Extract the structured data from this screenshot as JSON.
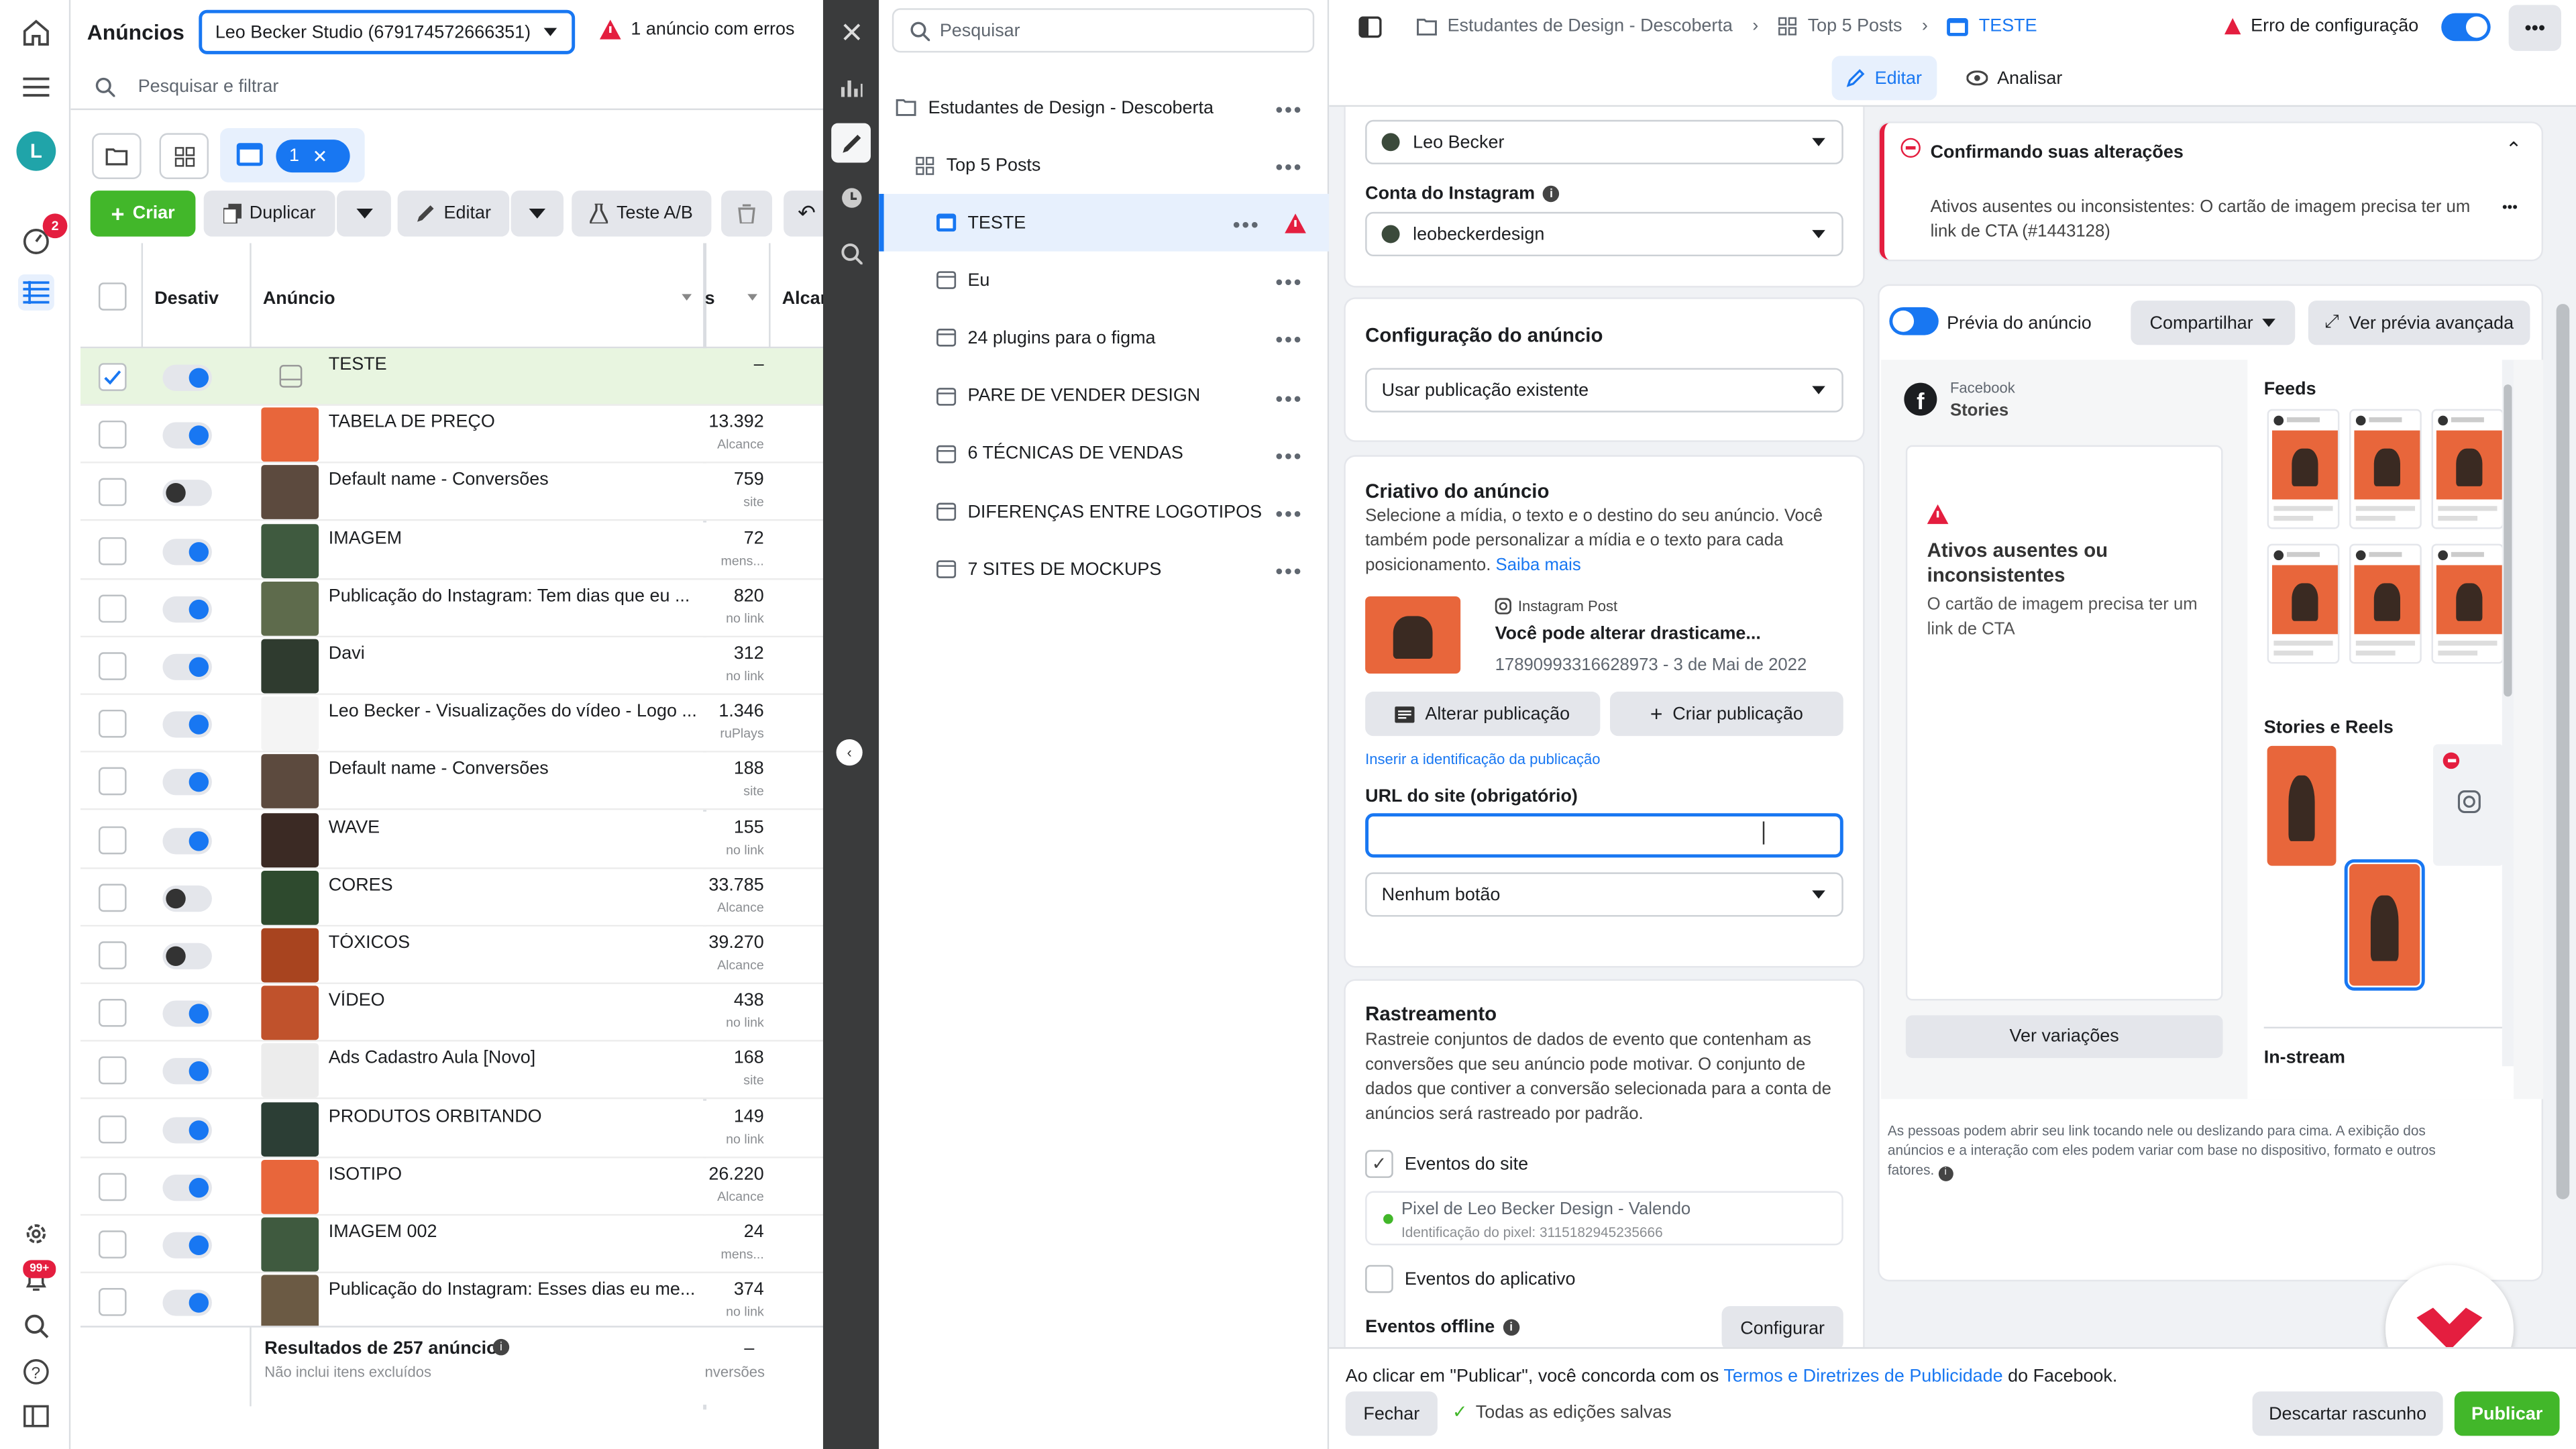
{
  "ads_panel": {
    "title": "Anúncios",
    "account": "Leo Becker Studio (679174572666351)",
    "error_notice": "1 anúncio com erros",
    "search_placeholder": "Pesquisar e filtrar",
    "selection_count": "1",
    "create": "Criar",
    "duplicate": "Duplicar",
    "edit": "Editar",
    "ab_test": "Teste A/B",
    "col_off": "Desativ",
    "col_ad": "Anúncio",
    "col_s": "s",
    "col_reach": "Alcan",
    "footer_title": "Resultados de 257 anúncios",
    "footer_sub": "Não inclui itens excluídos",
    "footer_dash": "–",
    "footer_sub_right": "nversões"
  },
  "rows": [
    {
      "name": "TESTE",
      "value": "–",
      "sub": "",
      "on": true,
      "thumb": "placeholder"
    },
    {
      "name": "TABELA DE PREÇO",
      "value": "13.392",
      "sub": "Alcance",
      "on": true,
      "thumb": "#e8663b"
    },
    {
      "name": "Default name - Conversões",
      "value": "759",
      "sub": "site",
      "on": false,
      "thumb": "#5c4a3e"
    },
    {
      "name": "IMAGEM",
      "value": "72",
      "sub": "mens...",
      "on": true,
      "thumb": "#3f5a3f"
    },
    {
      "name": "Publicação do Instagram: Tem dias que eu ...",
      "value": "820",
      "sub": "no link",
      "on": true,
      "thumb": "#5e6b4c"
    },
    {
      "name": "Davi",
      "value": "312",
      "sub": "no link",
      "on": true,
      "thumb": "#2f3b2f"
    },
    {
      "name": "Leo Becker - Visualizações do vídeo - Logo ...",
      "value": "1.346",
      "sub": "ruPlays",
      "on": true,
      "thumb": "#f4f4f4"
    },
    {
      "name": "Default name - Conversões",
      "value": "188",
      "sub": "site",
      "on": true,
      "thumb": "#5c4a3e"
    },
    {
      "name": "WAVE",
      "value": "155",
      "sub": "no link",
      "on": true,
      "thumb": "#3b2a24"
    },
    {
      "name": "CORES",
      "value": "33.785",
      "sub": "Alcance",
      "on": false,
      "thumb": "#2e4a2e"
    },
    {
      "name": "TÓXICOS",
      "value": "39.270",
      "sub": "Alcance",
      "on": false,
      "thumb": "#a8441f"
    },
    {
      "name": "VÍDEO",
      "value": "438",
      "sub": "no link",
      "on": true,
      "thumb": "#c0522c"
    },
    {
      "name": "Ads Cadastro Aula [Novo]",
      "value": "168",
      "sub": "site",
      "on": true,
      "thumb": "#ececec"
    },
    {
      "name": "PRODUTOS ORBITANDO",
      "value": "149",
      "sub": "no link",
      "on": true,
      "thumb": "#2c3e35"
    },
    {
      "name": "ISOTIPO",
      "value": "26.220",
      "sub": "Alcance",
      "on": true,
      "thumb": "#e8663b"
    },
    {
      "name": "IMAGEM 002",
      "value": "24",
      "sub": "mens...",
      "on": true,
      "thumb": "#3f5a3f"
    },
    {
      "name": "Publicação do Instagram: Esses dias eu me...",
      "value": "374",
      "sub": "no link",
      "on": true,
      "thumb": "#6b5a44"
    }
  ],
  "tree": {
    "search_placeholder": "Pesquisar",
    "campaign": "Estudantes de Design - Descoberta",
    "adset": "Top 5 Posts",
    "items": [
      "TESTE",
      "Eu",
      "24 plugins para o figma",
      "PARE DE VENDER DESIGN",
      "6 TÉCNICAS DE VENDAS",
      "DIFERENÇAS ENTRE LOGOTIPOS",
      "7 SITES DE MOCKUPS"
    ]
  },
  "editor": {
    "breadcrumb": [
      "Estudantes de Design - Descoberta",
      "Top 5 Posts",
      "TESTE"
    ],
    "config_error": "Erro de configuração",
    "tab_edit": "Editar",
    "tab_analyze": "Analisar",
    "page_select": "Leo Becker",
    "ig_label": "Conta do Instagram",
    "ig_select": "leobeckerdesign",
    "adconfig_title": "Configuração do anúncio",
    "adconfig_select": "Usar publicação existente",
    "creative_title": "Criativo do anúncio",
    "creative_desc": "Selecione a mídia, o texto e o destino do seu anúncio. Você também pode personalizar a mídia e o texto para cada posicionamento.",
    "learn_more": "Saiba mais",
    "post_source": "Instagram Post",
    "post_title": "Você pode alterar drasticame...",
    "post_meta": "17890993316628973 - 3 de Mai de 2022",
    "change_post": "Alterar publicação",
    "create_post": "Criar publicação",
    "insert_id": "Inserir a identificação da publicação",
    "url_label": "URL do site (obrigatório)",
    "cta_select": "Nenhum botão",
    "tracking_title": "Rastreamento",
    "tracking_desc": "Rastreie conjuntos de dados de evento que contenham as conversões que seu anúncio pode motivar. O conjunto de dados que contiver a conversão selecionada para a conta de anúncios será rastreado por padrão.",
    "site_events": "Eventos do site",
    "pixel_name": "Pixel de Leo Becker Design - Valendo",
    "pixel_id": "Identificação do pixel: 3115182945235666",
    "app_events": "Eventos do aplicativo",
    "offline_events": "Eventos offline",
    "configure": "Configurar",
    "terms_pre": "Ao clicar em \"Publicar\", você concorda com os ",
    "terms_link": "Termos e Diretrizes de Publicidade",
    "terms_post": " do Facebook.",
    "close": "Fechar",
    "saved": "Todas as edições salvas",
    "discard": "Descartar rascunho",
    "publish": "Publicar"
  },
  "preview": {
    "alert_title": "Confirmando suas alterações",
    "alert_text": "Ativos ausentes ou inconsistentes: O cartão de imagem precisa ter um link de CTA (#1443128)",
    "preview_toggle": "Prévia do anúncio",
    "share": "Compartilhar",
    "advanced": "Ver prévia avançada",
    "fb_label": "Facebook",
    "fb_placement": "Stories",
    "missing_title": "Ativos ausentes ou inconsistentes",
    "missing_text": "O cartão de imagem precisa ter um link de CTA",
    "variations": "Ver variações",
    "feeds": "Feeds",
    "stories_reels": "Stories e Reels",
    "instream": "In-stream",
    "note": "As pessoas podem abrir seu link tocando nele ou deslizando para cima. A exibição dos anúncios e a interação com eles podem variar com base no dispositivo, formato e outros fatores."
  },
  "badges": {
    "notif": "2",
    "alerts": "99+"
  },
  "colors": {
    "brand_blue": "#1877f2",
    "green": "#42b72a",
    "poster": "#e8663b",
    "error": "#e41e3f"
  }
}
